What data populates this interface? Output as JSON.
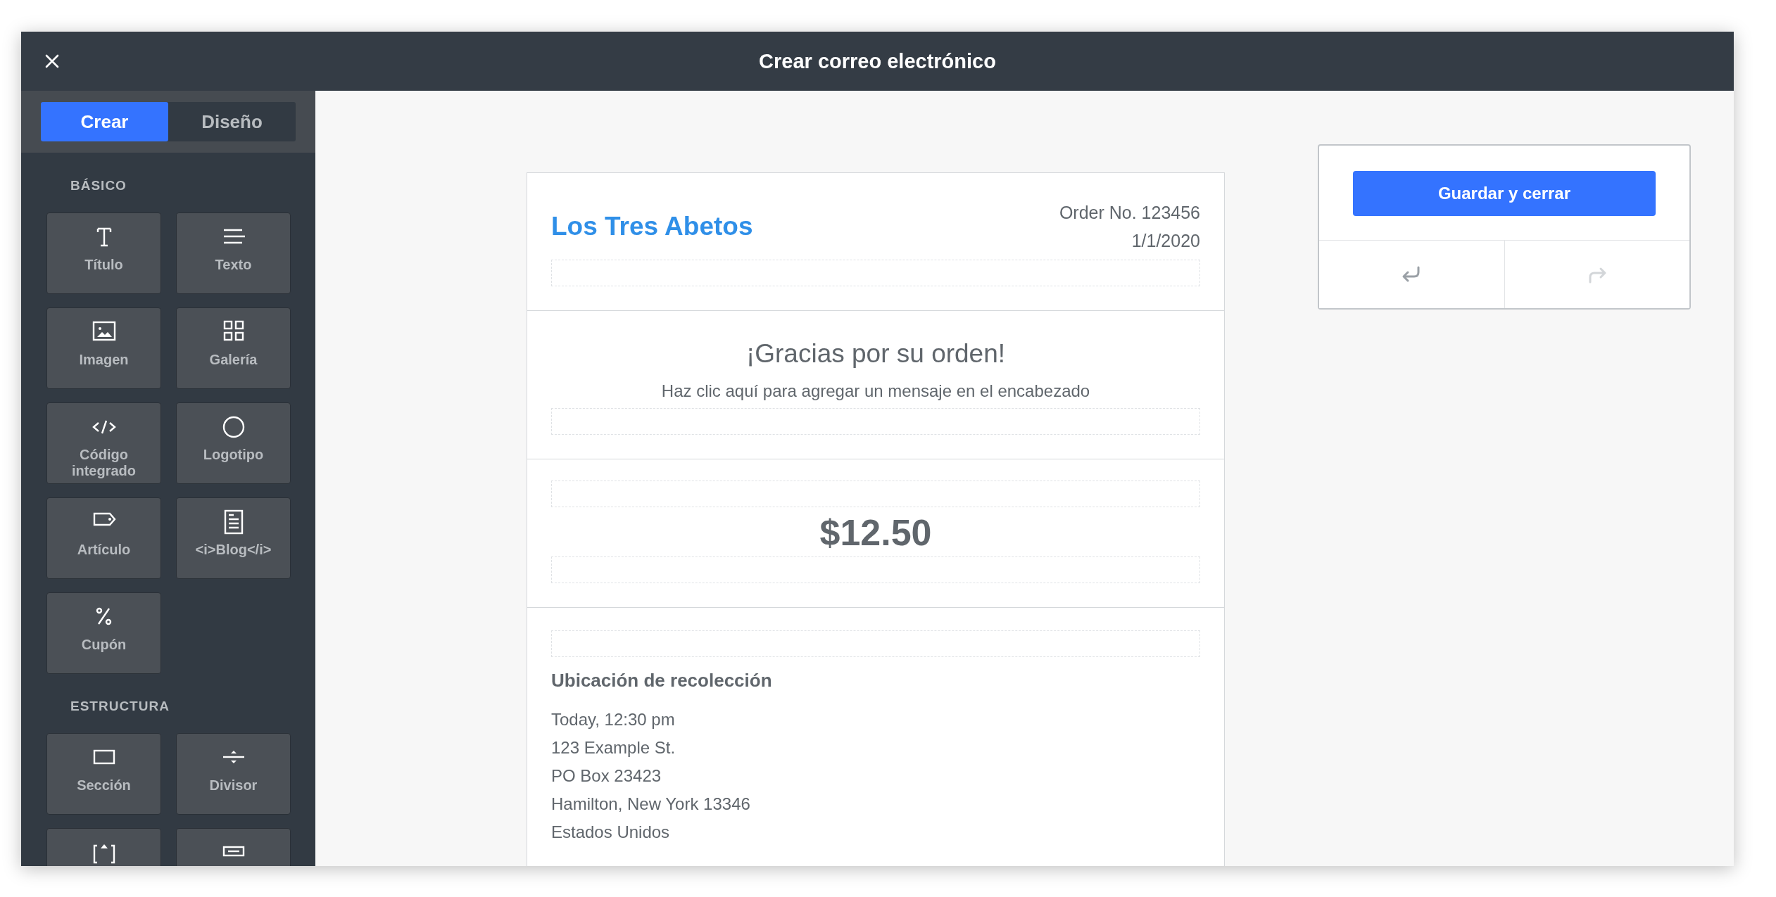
{
  "window": {
    "title": "Crear correo electrónico"
  },
  "tabs": [
    {
      "label": "Crear",
      "selected": true
    },
    {
      "label": "Diseño",
      "selected": false
    }
  ],
  "sidebar": {
    "sections": [
      {
        "heading": "BÁSICO",
        "tiles": [
          {
            "kind": "title",
            "label": "Título"
          },
          {
            "kind": "text",
            "label": "Texto"
          },
          {
            "kind": "image",
            "label": "Imagen"
          },
          {
            "kind": "gallery",
            "label": "Galería"
          },
          {
            "kind": "code",
            "label": "Código integrado"
          },
          {
            "kind": "logo",
            "label": "Logotipo"
          },
          {
            "kind": "product",
            "label": "Artículo"
          },
          {
            "kind": "blog",
            "label": "<i>Blog</i>"
          },
          {
            "kind": "coupon",
            "label": "Cupón"
          }
        ]
      },
      {
        "heading": "ESTRUCTURA",
        "tiles": [
          {
            "kind": "section",
            "label": "Sección"
          },
          {
            "kind": "divider",
            "label": "Divisor"
          },
          {
            "kind": "spacer"
          },
          {
            "kind": "button"
          }
        ]
      }
    ]
  },
  "email": {
    "header": {
      "brand": "Los Tres Abetos",
      "order_number": "Order No. 123456",
      "date": "1/1/2020"
    },
    "greeting": {
      "heading": "¡Gracias por su orden!",
      "message": "Haz clic aquí para agregar un mensaje en el encabezado"
    },
    "total": "$12.50",
    "pickup": {
      "heading": "Ubicación de recolección",
      "lines": [
        "Today, 12:30 pm",
        "123 Example St.",
        "PO Box 23423",
        "Hamilton, New York 13346",
        "Estados Unidos"
      ]
    }
  },
  "panel": {
    "save_button": "Guardar y cerrar",
    "undo": {
      "disabled": false
    },
    "redo": {
      "disabled": true
    }
  }
}
